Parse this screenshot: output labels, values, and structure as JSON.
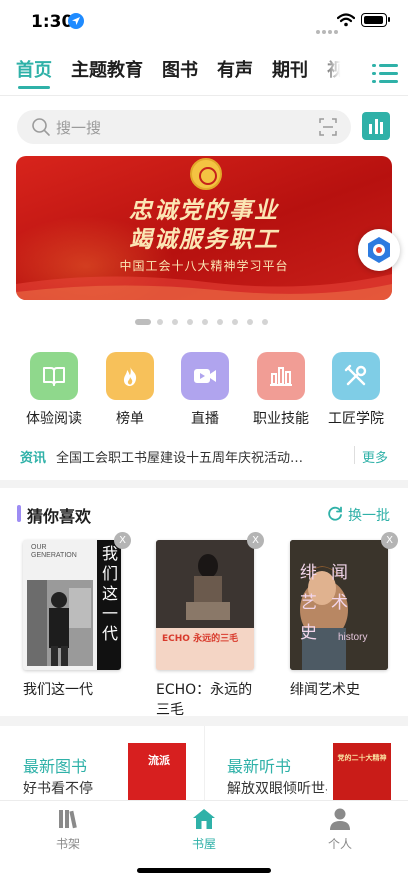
{
  "status_bar": {
    "time": "1:30"
  },
  "tabs": [
    {
      "label": "首页",
      "active": true
    },
    {
      "label": "主题教育",
      "active": false
    },
    {
      "label": "图书",
      "active": false
    },
    {
      "label": "有声",
      "active": false
    },
    {
      "label": "期刊",
      "active": false
    },
    {
      "label": "视",
      "active": false
    }
  ],
  "search": {
    "placeholder": "搜一搜"
  },
  "banner": {
    "line1": "忠诚党的事业",
    "line2": "竭诚服务职工",
    "subtitle": "中国工会十八大精神学习平台",
    "dot_count": 9,
    "active_dot": 0
  },
  "quick_entries": [
    {
      "label": "体验阅读",
      "color": "#8fd88c",
      "icon": "book-icon"
    },
    {
      "label": "榜单",
      "color": "#f7c15a",
      "icon": "flame-icon"
    },
    {
      "label": "直播",
      "color": "#b0a4ee",
      "icon": "video-icon"
    },
    {
      "label": "职业技能",
      "color": "#f19d95",
      "icon": "bar-chart-icon"
    },
    {
      "label": "工匠学院",
      "color": "#7fcde6",
      "icon": "tools-icon"
    }
  ],
  "news": {
    "tag": "资讯",
    "text": "全国工会职工书屋建设十五周年庆祝活动…",
    "more": "更多"
  },
  "recommend": {
    "title": "猜你喜欢",
    "refresh_label": "换一批",
    "books": [
      {
        "title": "我们这一代",
        "cover_text": "我们这一代",
        "cover_en": "OUR GENERATION"
      },
      {
        "title": "ECHO：永远的三毛",
        "cover_text": "ECHO 永远的三毛"
      },
      {
        "title": "绯闻艺术史",
        "cover_text": "绯闻艺术史",
        "cover_en": "history"
      }
    ],
    "close_label": "X"
  },
  "promos": [
    {
      "title": "最新图书",
      "subtitle": "好书看不停",
      "cover_text": "流派"
    },
    {
      "title": "最新听书",
      "subtitle": "解放双眼倾听世界",
      "cover_text": "党的二十大精神"
    }
  ],
  "tabbar": [
    {
      "label": "书架",
      "active": false
    },
    {
      "label": "书屋",
      "active": true
    },
    {
      "label": "个人",
      "active": false
    }
  ]
}
